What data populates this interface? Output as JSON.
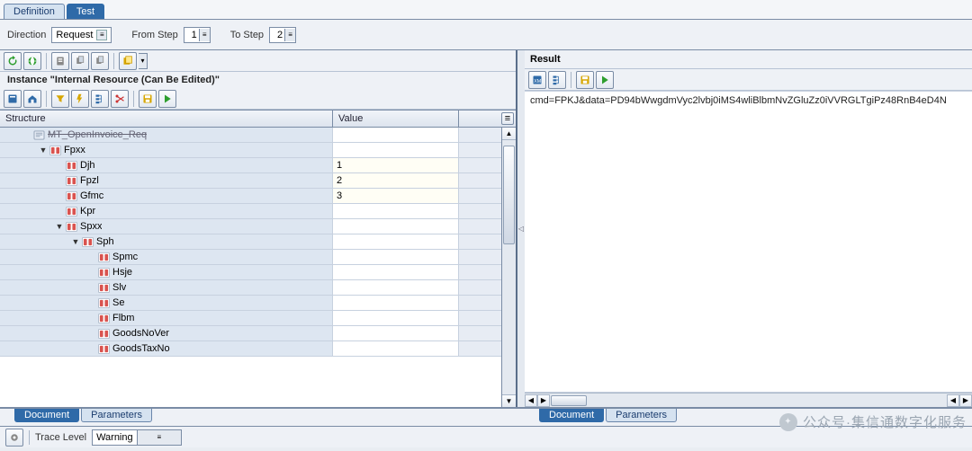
{
  "top_tabs": {
    "definition": "Definition",
    "test": "Test"
  },
  "filter": {
    "direction_label": "Direction",
    "direction_value": "Request",
    "from_step_label": "From Step",
    "from_step_value": "1",
    "to_step_label": "To Step",
    "to_step_value": "2"
  },
  "instance_title": "Instance \"Internal Resource (Can Be Edited)\"",
  "table": {
    "header_structure": "Structure",
    "header_value": "Value"
  },
  "tree": [
    {
      "indent": 1,
      "toggle": "",
      "icon": "doc",
      "label": "MT_OpenInvoice_Req",
      "value": "",
      "cut": true
    },
    {
      "indent": 2,
      "toggle": "▼",
      "icon": "brackets",
      "label": "Fpxx",
      "value": ""
    },
    {
      "indent": 3,
      "toggle": "",
      "icon": "brackets",
      "label": "Djh",
      "value": "1",
      "editable": true
    },
    {
      "indent": 3,
      "toggle": "",
      "icon": "brackets",
      "label": "Fpzl",
      "value": "2",
      "editable": true
    },
    {
      "indent": 3,
      "toggle": "",
      "icon": "brackets",
      "label": "Gfmc",
      "value": "3",
      "editable": true
    },
    {
      "indent": 3,
      "toggle": "",
      "icon": "brackets",
      "label": "Kpr",
      "value": ""
    },
    {
      "indent": 3,
      "toggle": "▼",
      "icon": "brackets",
      "label": "Spxx",
      "value": ""
    },
    {
      "indent": 4,
      "toggle": "▼",
      "icon": "brackets",
      "label": "Sph",
      "value": ""
    },
    {
      "indent": 5,
      "toggle": "",
      "icon": "brackets",
      "label": "Spmc",
      "value": ""
    },
    {
      "indent": 5,
      "toggle": "",
      "icon": "brackets",
      "label": "Hsje",
      "value": ""
    },
    {
      "indent": 5,
      "toggle": "",
      "icon": "brackets",
      "label": "Slv",
      "value": ""
    },
    {
      "indent": 5,
      "toggle": "",
      "icon": "brackets",
      "label": "Se",
      "value": ""
    },
    {
      "indent": 5,
      "toggle": "",
      "icon": "brackets",
      "label": "Flbm",
      "value": ""
    },
    {
      "indent": 5,
      "toggle": "",
      "icon": "brackets",
      "label": "GoodsNoVer",
      "value": ""
    },
    {
      "indent": 5,
      "toggle": "",
      "icon": "brackets",
      "label": "GoodsTaxNo",
      "value": ""
    }
  ],
  "left_bottom_tabs": {
    "document": "Document",
    "parameters": "Parameters"
  },
  "right": {
    "title": "Result",
    "text": "cmd=FPKJ&data=PD94bWwgdmVyc2lvbj0iMS4wliBlbmNvZGluZz0iVVRGLTgiPz48RnB4eD4N"
  },
  "right_bottom_tabs": {
    "document": "Document",
    "parameters": "Parameters"
  },
  "trace": {
    "label": "Trace Level",
    "value": "Warning"
  },
  "watermark": "公众号·集信通数字化服务",
  "icons": {
    "dropdown": "▾",
    "stepmenu": "≡",
    "collapse": "◁",
    "up": "▲",
    "down": "▼",
    "left": "◀",
    "right": "▶"
  }
}
